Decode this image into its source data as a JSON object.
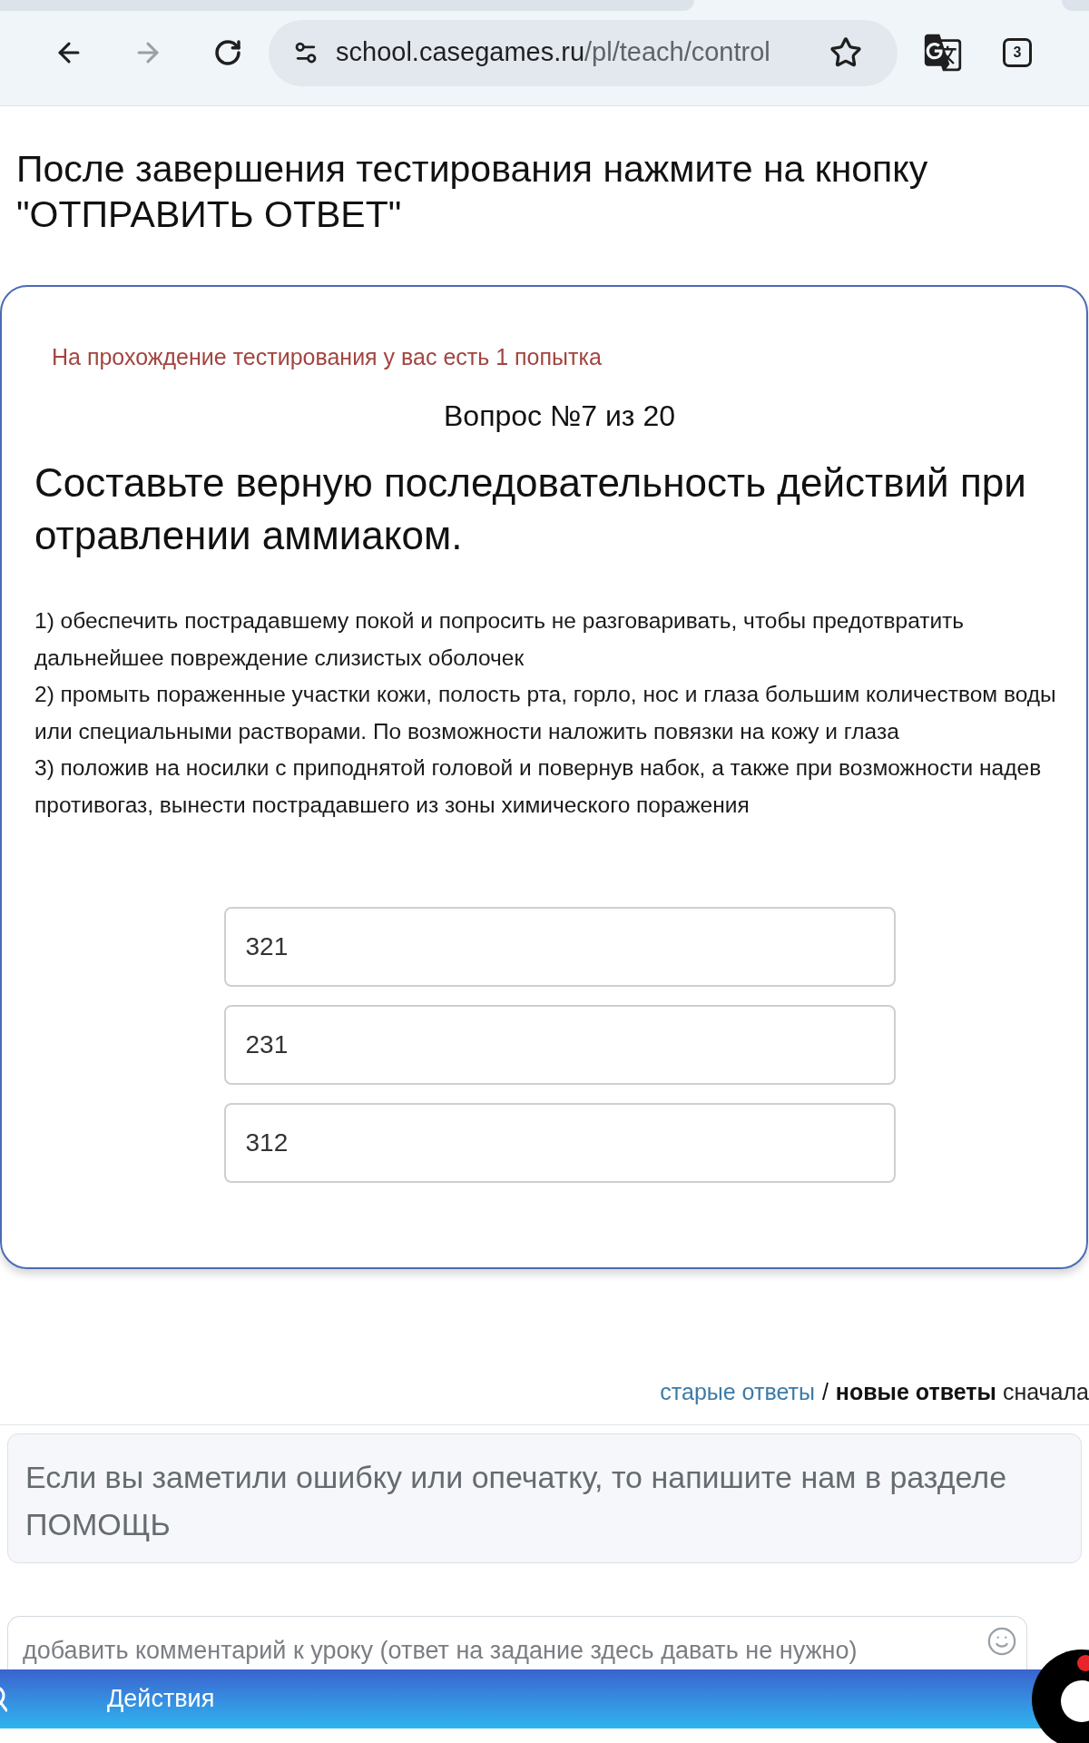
{
  "browser": {
    "url_host": "school.casegames.ru",
    "url_path": "/pl/teach/control",
    "tab_count": "3",
    "forward_disabled": true
  },
  "instruction": "После завершения тестирования нажмите на кнопку \"ОТПРАВИТЬ ОТВЕТ\"",
  "test_card": {
    "attempts_notice": "На прохождение тестирования у вас есть 1 попытка",
    "question_number": "Вопрос №7 из 20",
    "question": "Составьте верную последовательность действий при отравлении аммиаком.",
    "steps": [
      "1) обеспечить пострадавшему покой и попросить не разговаривать, чтобы предотвратить дальнейшее повреждение слизистых оболочек",
      "2) промыть пораженные участки кожи, полость рта, горло, нос и глаза большим количеством воды или специальными растворами. По возможности наложить повязки на кожу и глаза",
      "3) положив на носилки с приподнятой головой и повернув набок, а также при возможности надев противогаз, вынести пострадавшего из зоны химического поражения"
    ],
    "answers": [
      "321",
      "231",
      "312"
    ]
  },
  "answer_sort": {
    "options": [
      {
        "label": "старые ответы",
        "selected": false
      },
      {
        "label": "новые ответы",
        "selected": true
      }
    ],
    "separator": "/",
    "suffix": "сначала"
  },
  "error_notice": "Если вы заметили ошибку или опечатку, то напишите нам в разделе ПОМОЩЬ",
  "comment": {
    "placeholder": "добавить комментарий к уроку (ответ на задание здесь давать не нужно)"
  },
  "bottom_bar": {
    "label": "Действия"
  }
}
